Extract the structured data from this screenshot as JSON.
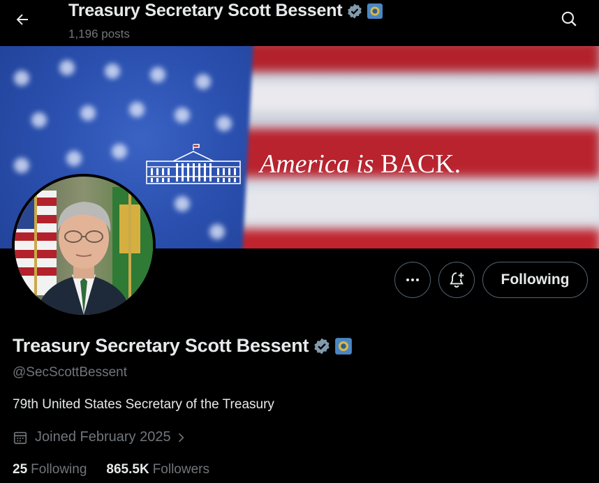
{
  "header": {
    "title": "Treasury Secretary Scott Bessent",
    "posts_count": "1,196 posts"
  },
  "banner": {
    "tagline_italic": "America is",
    "tagline_caps": "BACK."
  },
  "profile": {
    "display_name": "Treasury Secretary Scott Bessent",
    "handle": "@SecScottBessent",
    "bio": "79th United States Secretary of the Treasury",
    "joined": "Joined February 2025",
    "following_count": "25",
    "following_label": "Following",
    "followers_count": "865.5K",
    "followers_label": "Followers"
  },
  "actions": {
    "follow_state_label": "Following"
  },
  "icons": {
    "back": "arrow-left-icon",
    "search": "search-icon",
    "more": "more-horizontal-icon",
    "notify": "bell-plus-icon",
    "verified": "verified-badge-icon",
    "gov": "government-badge-icon",
    "calendar": "calendar-icon",
    "chevron": "chevron-right-icon"
  },
  "colors": {
    "background": "#000000",
    "text_primary": "#e7e9ea",
    "text_secondary": "#71767b",
    "border": "#536471",
    "verified_badge": "#829aab",
    "flag_red": "#b3222c",
    "flag_blue": "#2a4fae"
  }
}
